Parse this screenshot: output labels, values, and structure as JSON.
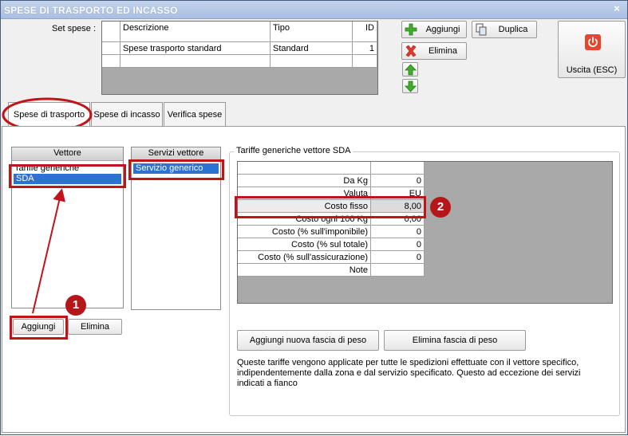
{
  "window": {
    "title": "SPESE DI TRASPORTO ED INCASSO",
    "close_symbol": "×"
  },
  "set_spese": {
    "label": "Set spese :",
    "columns": [
      "Descrizione",
      "Tipo",
      "ID"
    ],
    "rows": [
      {
        "descrizione": "Spese trasporto standard",
        "tipo": "Standard",
        "id": "1"
      }
    ]
  },
  "toolbar": {
    "aggiungi": "Aggiungi",
    "duplica": "Duplica",
    "elimina": "Elimina",
    "uscita": "Uscita (ESC)"
  },
  "tabs": [
    {
      "label": "Spese di trasporto",
      "active": true
    },
    {
      "label": "Spese di incasso",
      "active": false
    },
    {
      "label": "Verifica spese",
      "active": false
    }
  ],
  "vettore": {
    "header": "Vettore",
    "items": [
      "Tariffe generiche",
      "SDA"
    ],
    "selected": "SDA",
    "add_button": "Aggiungi",
    "delete_button": "Elimina"
  },
  "servizi": {
    "header": "Servizi vettore",
    "items": [
      "Servizio generico"
    ],
    "selected": "Servizio generico"
  },
  "tariffe": {
    "group_title": "Tariffe generiche vettore SDA",
    "rows": [
      {
        "label": "Da Kg",
        "value": "0"
      },
      {
        "label": "Valuta",
        "value": "EU"
      },
      {
        "label": "Costo fisso",
        "value": "8,00"
      },
      {
        "label": "Costo ogni 100 Kg",
        "value": "0,00"
      },
      {
        "label": "Costo (% sull'imponibile)",
        "value": "0"
      },
      {
        "label": "Costo (% sul totale)",
        "value": "0"
      },
      {
        "label": "Costo (% sull'assicurazione)",
        "value": "0"
      },
      {
        "label": "Note",
        "value": ""
      }
    ],
    "add_band_button": "Aggiungi nuova fascia di peso",
    "delete_band_button": "Elimina fascia di peso",
    "info_text": "Queste tariffe vengono applicate per tutte le spedizioni effettuate con il vettore specifico, indipendentemente dalla zona e dal servizio specificato. Questo ad eccezione dei servizi indicati a fianco"
  },
  "annotations": {
    "marker1": "1",
    "marker2": "2"
  },
  "colors": {
    "accent_red": "#c0141a",
    "selection_blue": "#2a73d1",
    "title_bar": "#b4c7e7"
  }
}
